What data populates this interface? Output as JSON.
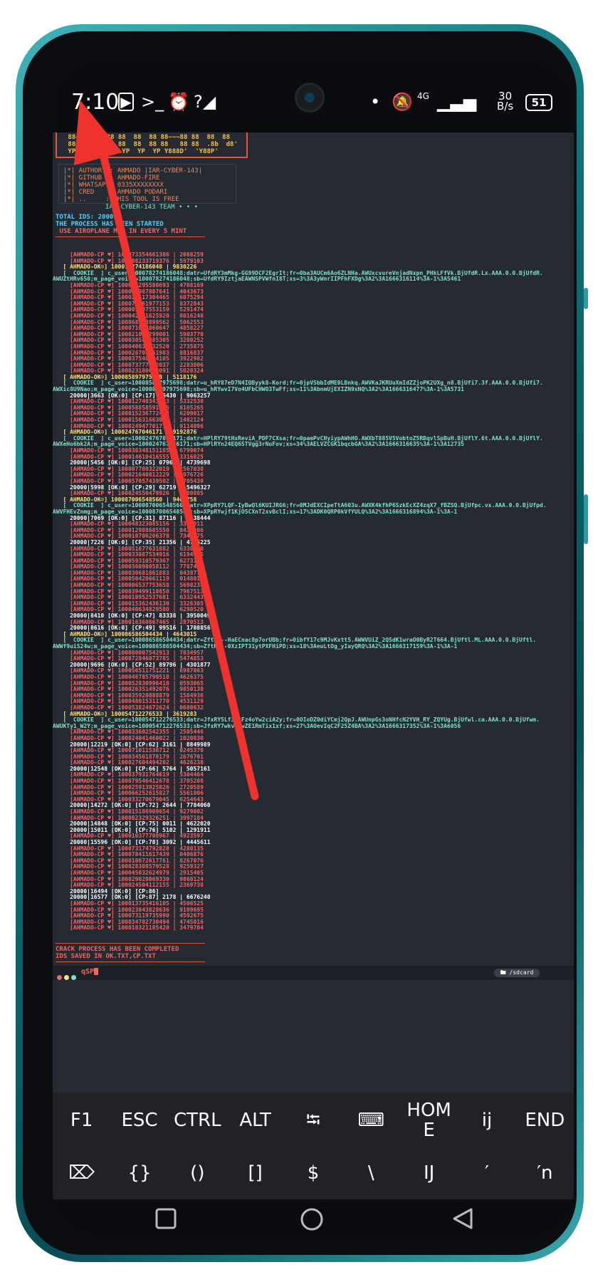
{
  "status_bar": {
    "time": "7:10",
    "net_speed_top": "30",
    "net_speed_bottom": "B/s",
    "battery": "51",
    "network": "4G"
  },
  "banner": {
    "ascii": " 88~~~88~~~88 88  88  88 88~~~88 88  88  88\n 88  8 8  88  88  88  88 88   88 88  .8b  d8'\n YP  YP  YP YP YP  YP  YP Y888D'  'Y88P'"
  },
  "info": {
    "lines": [
      "|*| AUTHOR  : AHMADO |IAR-CYBER-143|",
      "|*| GITHUB  : AHMADO-FIRE",
      "|*| WHATSAPP: 0335XXXXXXXX",
      "|*| CRED    : AHMADO PODARI",
      "|*| ..     : THIS TOOL IS FREE"
    ],
    "team": "IAR-CYBER-143 TEAM • • •"
  },
  "summary": {
    "total_ids": "TOTAL IDS: 20000",
    "process": "THE PROCESS HAS BEEN STARTED",
    "airplane": " USE AIROPLANE MOD IN EVERY 5 MINT"
  },
  "log_lines": [
    {
      "t": "ahm",
      "s": "     [AHMADO-CP ♥] 100073354661386 | 2088259"
    },
    {
      "t": "ahm",
      "s": "     [AHMADO-CP ♥] 100008233719376 | 5979103"
    },
    {
      "t": "ok",
      "s": "   [ AHMADO-OK☺] 100078274186048 | 9830226"
    },
    {
      "t": "ck",
      "s": "   [  COOKIE  ] c_user=100078274186048;datr=UfdRY3mMkg-GG99DCF2EgrIt;fr=0ba3AUCm6Ao6ZLNHa.AWUxcvureVnjadNxpn_PHkLFfVk.BjUfdR.Lx.AAA.0.0.BjUfdR."
    },
    {
      "t": "ck",
      "s": "AWUZtHRv650;m_page_voice=100078274186048;sb=UfdRY9IztjaEAWNSPVWfnI8T;xs=3%3A3yWnrIIPFhFXDg%3A2%3A1666316114%3A-1%3A5461"
    },
    {
      "t": "ahm",
      "s": "     [AHMADO-CP ♥] 100024295580693 | 4708169"
    },
    {
      "t": "ahm",
      "s": "     [AHMADO-CP ♥] 100017987807641 | 4043673"
    },
    {
      "t": "ahm",
      "s": "     [AHMADO-CP ♥] 100025517304465 | 6075294"
    },
    {
      "t": "ahm",
      "s": "     [AHMADO-CP ♥] 100078361977153 | 8372843"
    },
    {
      "t": "ahm",
      "s": "     [AHMADO-CP ♥] 100001597553159 | 5291474"
    },
    {
      "t": "ahm",
      "s": "     [AHMADO-CP ♥] 100042091625920 | 8016248"
    },
    {
      "t": "ahm",
      "s": "     [AHMADO-CP ♥] 100068128899562 | 5062553"
    },
    {
      "t": "ahm",
      "s": "     [AHMADO-CP ♥] 100071047060647 | 4858227"
    },
    {
      "t": "ahm",
      "s": "     [AHMADO-CP ♥] 100021052299001 | 5903770"
    },
    {
      "t": "ahm",
      "s": "     [AHMADO-CP ♥] 100030585885305 | 3280252"
    },
    {
      "t": "ahm",
      "s": "     [AHMADO-CP ♥] 100040632932520 | 2735875"
    },
    {
      "t": "ahm",
      "s": "     [AHMADO-CP ♥] 100026705461983 | 8816837"
    },
    {
      "t": "ahm",
      "s": "     [AHMADO-CP ♥] 100037540654105 | 3922982"
    },
    {
      "t": "ahm",
      "s": "     [AHMADO-CP ♥] 100073777922037 | 2283806"
    },
    {
      "t": "ahm",
      "s": "     [AHMADO-CP ♥] 100023180629091 | 5020324"
    },
    {
      "t": "ok",
      "s": "   [ AHMADO-OK☺] 100085897975698 | 5118176"
    },
    {
      "t": "ck",
      "s": "   [  COOKIE  ] c_user=100085897975698;datr=u_hRY87eD7N4IQByyk8-Kord;fr=0jpVSbbIdME0LBnkq.AWVKaJKRUuXmIdZZjoPK2UXg_n8.BjUfi7.3f.AAA.0.0.BjUfi7."
    },
    {
      "t": "ck",
      "s": "AWXic8U9Nao;m_page_voice=100085897975698;sb=u_hRYwvI7Vo4UFbCHWO3TwFf;xs=11%3AbnmUjEXIZN9xNQ%3A2%3A1666316477%3A-1%3A5731"
    },
    {
      "t": "cp",
      "s": "     20000|3663 [OK:0] [CP:17] 16430 | 9063257"
    },
    {
      "t": "ahm",
      "s": "     [AHMADO-CP ♥] 100012740343403 | 5332530"
    },
    {
      "t": "ahm",
      "s": "     [AHMADO-CP ♥] 100058858591656 | 8165265"
    },
    {
      "t": "ahm",
      "s": "     [AHMADO-CP ♥] 100015236772464 | 6209017"
    },
    {
      "t": "ahm",
      "s": "     [AHMADO-CP ♥] 100015631663059 | 1482124"
    },
    {
      "t": "ahm",
      "s": "     [AHMADO-CP ♥] 100024947701773 | 9114096"
    },
    {
      "t": "ok",
      "s": "   [ AHMADO-OK☺] 100024767046171 | 9192876"
    },
    {
      "t": "ck",
      "s": "   [  COOKIE  ] c_user=100024767046171;datr=HPlRY79tHxReviA_PDF7CXsa;fr=0pamPvCHyiypAWhHO.AWXbT885V5VobtoZ5RBqvlSpBuH.BjUflY.6t.AAA.0.0.BjUflY."
    },
    {
      "t": "ck",
      "s": "AWXeHo6bk2A;m_page_voice=100024767046171;sb=HPlRYn24EQ6STVgg3rNuFov;xs=34%3AELVZCGK1bqcbGA%3A2%3A1666316635%3A-1%3A12735"
    },
    {
      "t": "ahm",
      "s": "     [AHMADO-CP ♥] 100030348151185 | 6799074"
    },
    {
      "t": "ahm",
      "s": "     [AHMADO-CP ♥] 100014610416555 | 3316025"
    },
    {
      "t": "cp",
      "s": "     20000|5456 [OK:0] [CP:25] 07965 | 4739698"
    },
    {
      "t": "ahm",
      "s": "     [AHMADO-CP ♥] 100007780322019 | 2567038"
    },
    {
      "t": "ahm",
      "s": "     [AHMADO-CP ♥] 100021640812229 | 4976726"
    },
    {
      "t": "ahm",
      "s": "     [AHMADO-CP ♥] 100057057439502 | 3705430"
    },
    {
      "t": "cp",
      "s": "     20000|5998 [OK:0] [CP:29] 62719 | 5496327"
    },
    {
      "t": "ahm",
      "s": "     [AHMADO-CP ♥] 100024550479926 | 8680885"
    },
    {
      "t": "ok",
      "s": "   [ AHMADO-OK☺] 100087006548560 | 9409758"
    },
    {
      "t": "ck",
      "s": "   [  COOKIE  ] c_user=100087006548560;datr=XPpRY7LQF-IyBwQl6KUIJRG6;fr=0MJdEXCIpeTtA603u.AWXK4kfhP6SzkEcXZ4zqX7_fBZSQ.BjUfpc.vx.AAA.0.0.BjUfpd."
    },
    {
      "t": "ck",
      "s": "AWVFHEvZnmg;m_page_voice=100087006548560;sb=XPpRYwjf1KjO5CXnT2xvBclI;xs=17%3ADK0QRP0kVfYULQ%3A2%3A1666316894%3A-1%3A-1"
    },
    {
      "t": "cp",
      "s": "     20000|7069 [OK:0] [CP:31] 87116 | 2638444"
    },
    {
      "t": "ahm",
      "s": "     [AHMADO-CP ♥] 100048323085156 | 3336011"
    },
    {
      "t": "ahm",
      "s": "     [AHMADO-CP ♥] 100012988685550 | 8438806"
    },
    {
      "t": "ahm",
      "s": "     [AHMADO-CP ♥] 100010706206378 | 7346075"
    },
    {
      "t": "cp",
      "s": "     20000|7226 [OK:0] [CP:35] 21356 | 4725225"
    },
    {
      "t": "ahm",
      "s": "     [AHMADO-CP ♥] 100051677631882 | 6330420"
    },
    {
      "t": "ahm",
      "s": "     [AHMADO-CP ♥] 100033887534916 | 6194455"
    },
    {
      "t": "ahm",
      "s": "     [AHMADO-CP ♥] 100059310579367 | 6273191"
    },
    {
      "t": "ahm",
      "s": "     [AHMADO-CP ♥] 100036098058112 | 7787430"
    },
    {
      "t": "ahm",
      "s": "     [AHMADO-CP ♥] 100030681861883 | 8439770"
    },
    {
      "t": "ahm",
      "s": "     [AHMADO-CP ♥] 100050420661119 | 0148016"
    },
    {
      "t": "ahm",
      "s": "     [AHMADO-CP ♥] 100006537753658 | 5698238"
    },
    {
      "t": "ahm",
      "s": "     [AHMADO-CP ♥] 100039499110858 | 7967513"
    },
    {
      "t": "ahm",
      "s": "     [AHMADO-CP ♥] 100010952537681 | 6332443"
    },
    {
      "t": "ahm",
      "s": "     [AHMADO-CP ♥] 100015362436130 | 3326305"
    },
    {
      "t": "ahm",
      "s": "     [AHMADO-CP ♥] 100040634829580 | 6290520"
    },
    {
      "t": "cp",
      "s": "     20000|8410 [OK:0] [CP:47] 83338 | 3950049"
    },
    {
      "t": "ahm",
      "s": "     [AHMADO-CP ♥] 100016360867465 | 2870513"
    },
    {
      "t": "cp",
      "s": "     20000|8616 [OK:0] [CP:49] 99516 | 1708856"
    },
    {
      "t": "ok",
      "s": "   [ AHMADO-OK☺] 100086586504434 | 4643015"
    },
    {
      "t": "ck",
      "s": "   [  COOKIE  ] c_user=100086586504434;datr=ZftRY--HaECnac8p7orUBb;fr=0ibfY17c9MJvKxtt5.AWWVUiZ_2QSdK1wraO0ByR2T664.BjUftl.ML.AAA.0.0.BjUftl."
    },
    {
      "t": "ck",
      "s": "AWWf9uiS24w;m_page_voice=100086586504434;sb=ZftRY--0XzIPT31ytPXFHiPD;xs=18%3AeuLtOg_yIayQRQ%3A2%3A1666317159%3A-1%3A-1"
    },
    {
      "t": "ahm",
      "s": "     [AHMADO-CP ♥] 100080007542913 | 7834957"
    },
    {
      "t": "ahm",
      "s": "     [AHMADO-CP ♥] 100072846073785 | 5474853"
    },
    {
      "t": "cp",
      "s": "     20000|9696 [OK:0] [CP:52] 89796 | 4301877"
    },
    {
      "t": "ahm",
      "s": "     [AHMADO-CP ♥] 100056511751221 | 6987063"
    },
    {
      "t": "ahm",
      "s": "     [AHMADO-CP ♥] 100046785790518 | 4626375"
    },
    {
      "t": "ahm",
      "s": "     [AHMADO-CP ♥] 100052830996418 | 0593065"
    },
    {
      "t": "ahm",
      "s": "     [AHMADO-CP ♥] 100026351492076 | 9850138"
    },
    {
      "t": "ahm",
      "s": "     [AHMADO-CP ♥] 100035920888879 | 1584936"
    },
    {
      "t": "ahm",
      "s": "     [AHMADO-CP ♥] 100048015311770 | 4531129"
    },
    {
      "t": "ahm",
      "s": "     [AHMADO-CP ♥] 100053824672624 | 0680632"
    },
    {
      "t": "ok",
      "s": "   [ AHMADO-OK☺] 100054712276533 | 3619283"
    },
    {
      "t": "ck",
      "s": "   [  COOKIE  ] c_user=100054712276533;datr=JfxRY5Lf3BLFz4oYw2ciA2y;fr=0OIoDZ0diYCmj2QpJ.AWUnpGs3oNHfcN2YVH_RY_ZQYUg.BjUfwl.ca.AAA.0.0.BjUfwm."
    },
    {
      "t": "ck",
      "s": "AWUKTy1_W2Y;m_page_voice=100054712276533;sb=JfxRY7wkv1jwZE1RmTix1xf;xs=27%3AOevIqC2F25Z4BA%3A2%3A1666317352%3A-1%3A6056"
    },
    {
      "t": "ahm",
      "s": "     [AHMADO-CP ♥] 100033602542355 | 2505446"
    },
    {
      "t": "ahm",
      "s": "     [AHMADO-CP ♥] 100024041460022 | 1020830"
    },
    {
      "t": "cp",
      "s": "     20000|12219 [OK:0] [CP:62] 3161 | 8849989"
    },
    {
      "t": "ahm",
      "s": "     [AHMADO-CP ♥] 100071011536712 | 0245370"
    },
    {
      "t": "ahm",
      "s": "     [AHMADO-CP ♥] 100034561878179 | 2676701"
    },
    {
      "t": "ahm",
      "s": "     [AHMADO-CP ♥] 100027604494202 | 4626238"
    },
    {
      "t": "cp",
      "s": "     20000|12548 [OK:0] [CP:66] 5764 | 5057161"
    },
    {
      "t": "ahm",
      "s": "     [AHMADO-CP ♥] 100037931764619 | 5304464"
    },
    {
      "t": "ahm",
      "s": "     [AHMADO-CP ♥] 100079546412678 | 3705208"
    },
    {
      "t": "ahm",
      "s": "     [AHMADO-CP ♥] 100025913925826 | 2720589"
    },
    {
      "t": "ahm",
      "s": "     [AHMADO-CP ♥] 100066252615827 | 5561806"
    },
    {
      "t": "ahm",
      "s": "     [AHMADO-CP ♥] 100033270679045 | 6254643"
    },
    {
      "t": "cp",
      "s": "     20000|14272 [OK:0] [CP:72] 2644 | 7784060"
    },
    {
      "t": "ahm",
      "s": "     [AHMADO-CP ♥] 100015186909654 | 9279002"
    },
    {
      "t": "ahm",
      "s": "     [AHMADO-CP ♥] 100082329326251 | 3997184"
    },
    {
      "t": "cp",
      "s": "     20000|14848 [OK:0] [CP:75] 0011 | 4622020"
    },
    {
      "t": "cp",
      "s": "     20000|15011 [OK:0] [CP:76] 5102 | 1291911"
    },
    {
      "t": "ahm",
      "s": "     [AHMADO-CP ♥] 100010377708967 | 4923597"
    },
    {
      "t": "cp",
      "s": "     20000|15596 [OK:0] [CP:78] 3092 | 4445611"
    },
    {
      "t": "ahm",
      "s": "     [AHMADO-CP ♥] 100073174792828 | 4280135"
    },
    {
      "t": "ahm",
      "s": "     [AHMADO-CP ♥] 100078411617439 | 0406876"
    },
    {
      "t": "ahm",
      "s": "     [AHMADO-CP ♥] 100010072617761 | 8267076"
    },
    {
      "t": "ahm",
      "s": "     [AHMADO-CP ♥] 100028308570528 | 9259327"
    },
    {
      "t": "ahm",
      "s": "     [AHMADO-CP ♥] 100045032624979 | 2915405"
    },
    {
      "t": "ahm",
      "s": "     [AHMADO-CP ♥] 100029020069330 | 9860124"
    },
    {
      "t": "ahm",
      "s": "     [AHMADO-CP ♥] 100024504112155 | 2369738"
    },
    {
      "t": "cp",
      "s": "     20000|16494 [OK:0] [CP:86]"
    },
    {
      "t": "cp",
      "s": "     20000|16577 [OK:0] [CP:87] 2178 | 6676240"
    },
    {
      "t": "ahm",
      "s": "     [AHMADO-CP ♥] 100013735416105 | 4506525"
    },
    {
      "t": "ahm",
      "s": "     [AHMADO-CP ♥] 100023843828636 | 9109695"
    },
    {
      "t": "ahm",
      "s": "     [AHMADO-CP ♥] 100073119735990 | 4592675"
    },
    {
      "t": "ahm",
      "s": "     [AHMADO-CP ♥] 100034782730494 | 4745016"
    },
    {
      "t": "ahm",
      "s": "     [AHMADO-CP ♥] 100018321185420 | 3479704"
    }
  ],
  "footer": {
    "complete": "CRACK PROCESS HAS BEEN COMPLETED",
    "saved": "IDS SAVED IN OK.TXT,CP.TXT"
  },
  "prompt": {
    "command": "qSP",
    "directory": "/sdcard"
  },
  "extra_keys": {
    "row1": [
      "F1",
      "ESC",
      "CTRL",
      "ALT",
      "⭾",
      "⌨",
      "HOM\nE",
      "ij",
      "END"
    ],
    "row2": [
      "⌦",
      "{}",
      "()",
      "[]",
      "$",
      "\\",
      "IJ",
      "′",
      "′n"
    ]
  },
  "colors": {
    "terminal_bg": "#262a32",
    "cp_red": "#f06565",
    "ok_yellow": "#ffe07a",
    "cookie_teal": "#7fe3c9",
    "annotation_arrow": "#f0322e"
  }
}
